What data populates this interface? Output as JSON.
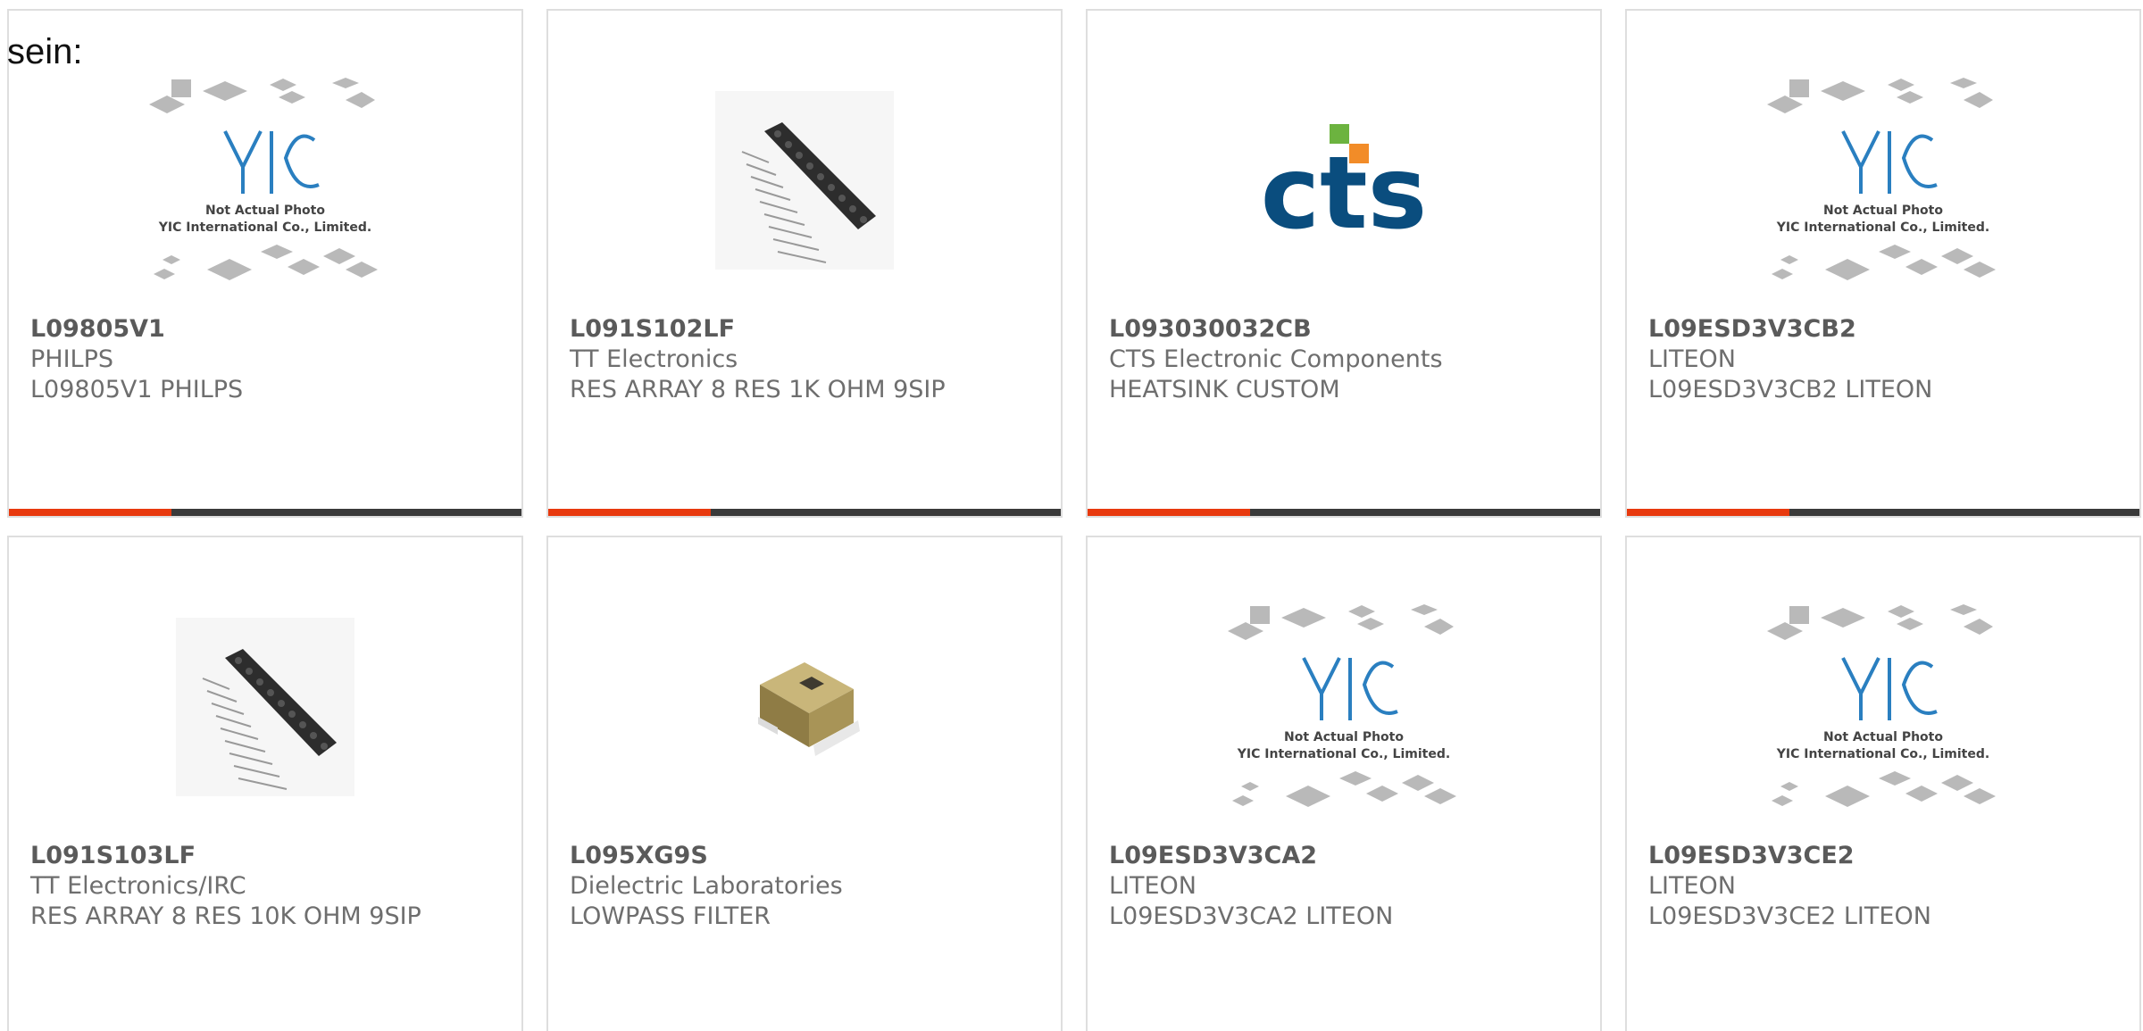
{
  "intro_text": "sein:",
  "products": [
    {
      "part_number": "L09805V1",
      "manufacturer": "PHILPS",
      "description": "L09805V1 PHILPS",
      "image": "yic-not-actual-photo",
      "placeholder": {
        "line1": "Not Actual Photo",
        "line2": "YIC International Co., Limited.",
        "logo": "YIC"
      }
    },
    {
      "part_number": "L091S102LF",
      "manufacturer": "TT Electronics",
      "description": "RES ARRAY 8 RES 1K OHM 9SIP",
      "image": "sip-resistor-array"
    },
    {
      "part_number": "L093030032CB",
      "manufacturer": "CTS Electronic Components",
      "description": "HEATSINK CUSTOM",
      "image": "cts-logo",
      "logo_text": "cts"
    },
    {
      "part_number": "L09ESD3V3CB2",
      "manufacturer": "LITEON",
      "description": "L09ESD3V3CB2 LITEON",
      "image": "yic-not-actual-photo",
      "placeholder": {
        "line1": "Not Actual Photo",
        "line2": "YIC International Co., Limited.",
        "logo": "YIC"
      }
    },
    {
      "part_number": "L091S103LF",
      "manufacturer": "TT Electronics/IRC",
      "description": "RES ARRAY 8 RES 10K OHM 9SIP",
      "image": "sip-resistor-array"
    },
    {
      "part_number": "L095XG9S",
      "manufacturer": "Dielectric Laboratories",
      "description": "LOWPASS FILTER",
      "image": "smd-filter-module"
    },
    {
      "part_number": "L09ESD3V3CA2",
      "manufacturer": "LITEON",
      "description": "L09ESD3V3CA2 LITEON",
      "image": "yic-not-actual-photo",
      "placeholder": {
        "line1": "Not Actual Photo",
        "line2": "YIC International Co., Limited.",
        "logo": "YIC"
      }
    },
    {
      "part_number": "L09ESD3V3CE2",
      "manufacturer": "LITEON",
      "description": "L09ESD3V3CE2 LITEON",
      "image": "yic-not-actual-photo",
      "placeholder": {
        "line1": "Not Actual Photo",
        "line2": "YIC International Co., Limited.",
        "logo": "YIC"
      }
    }
  ],
  "colors": {
    "accent": "#e8390e",
    "bar_dark": "#3a3a3a",
    "card_border": "#dedede",
    "text_bold": "#5a5a5a",
    "text_muted": "#6e6e6e",
    "cts_blue": "#0a4d7e",
    "cts_green": "#6cb33f",
    "cts_orange": "#f28c28"
  }
}
